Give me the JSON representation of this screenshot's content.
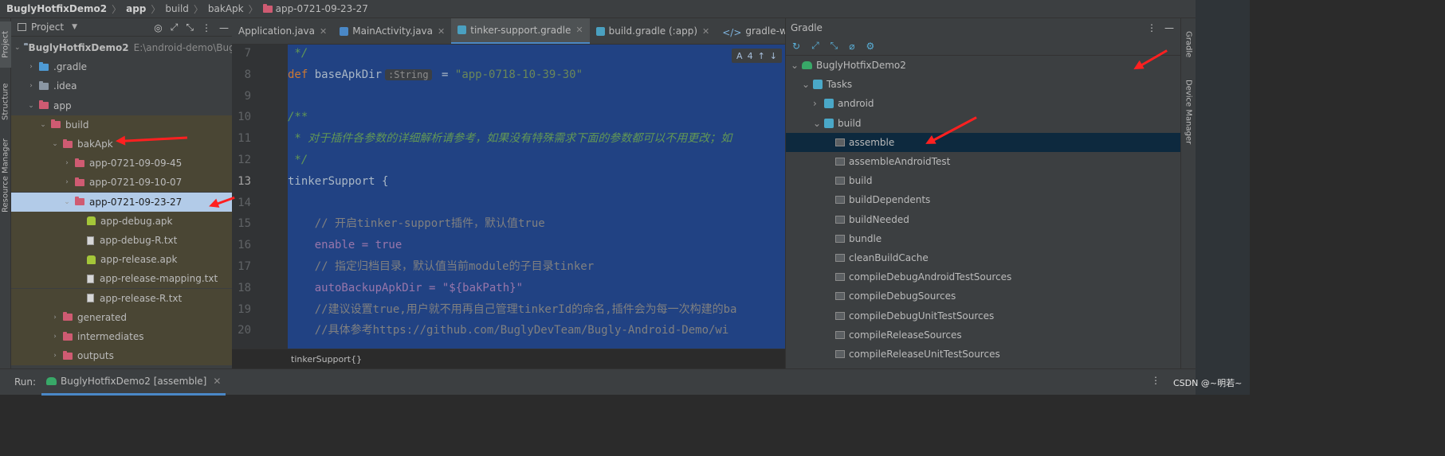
{
  "breadcrumb": {
    "items": [
      "BuglyHotfixDemo2",
      "app",
      "build",
      "bakApk",
      "app-0721-09-23-27"
    ],
    "separator": "〉"
  },
  "left_strip": {
    "tabs": [
      "Project",
      "Structure",
      "Resource Manager"
    ]
  },
  "project_panel": {
    "title": "Project",
    "tree": [
      {
        "label": "BuglyHotfixDemo2",
        "suffix": "E:\\android-demo\\BuglyHot",
        "depth": 0,
        "expanded": true,
        "icon": "folder-gray"
      },
      {
        "label": ".gradle",
        "depth": 1,
        "expanded": false,
        "icon": "folder-blue"
      },
      {
        "label": ".idea",
        "depth": 1,
        "expanded": false,
        "icon": "folder-gray"
      },
      {
        "label": "app",
        "depth": 1,
        "expanded": true,
        "icon": "folder-module"
      },
      {
        "label": "build",
        "depth": 2,
        "expanded": true,
        "icon": "folder-excluded"
      },
      {
        "label": "bakApk",
        "depth": 3,
        "expanded": true,
        "icon": "folder-excluded"
      },
      {
        "label": "app-0721-09-09-45",
        "depth": 4,
        "expanded": false,
        "icon": "folder-excluded"
      },
      {
        "label": "app-0721-09-10-07",
        "depth": 4,
        "expanded": false,
        "icon": "folder-excluded"
      },
      {
        "label": "app-0721-09-23-27",
        "depth": 4,
        "expanded": true,
        "icon": "folder-excluded",
        "selected": true
      },
      {
        "label": "app-debug.apk",
        "depth": 5,
        "icon": "apk"
      },
      {
        "label": "app-debug-R.txt",
        "depth": 5,
        "icon": "txt"
      },
      {
        "label": "app-release.apk",
        "depth": 5,
        "icon": "apk"
      },
      {
        "label": "app-release-mapping.txt",
        "depth": 5,
        "icon": "txt"
      },
      {
        "label": "app-release-R.txt",
        "depth": 5,
        "icon": "txt"
      },
      {
        "label": "generated",
        "depth": 3,
        "expanded": false,
        "icon": "folder-excluded"
      },
      {
        "label": "intermediates",
        "depth": 3,
        "expanded": false,
        "icon": "folder-excluded"
      },
      {
        "label": "outputs",
        "depth": 3,
        "expanded": false,
        "icon": "folder-excluded"
      }
    ]
  },
  "editor": {
    "tabs": [
      {
        "label": "Application.java",
        "active": false,
        "icon": "java-icon"
      },
      {
        "label": "MainActivity.java",
        "active": false,
        "icon": "java-icon"
      },
      {
        "label": "tinker-support.gradle",
        "active": true,
        "icon": "gradle-icon"
      },
      {
        "label": "build.gradle (:app)",
        "active": false,
        "icon": "gradle-icon"
      },
      {
        "label": "gradle-wrapper.propertie",
        "active": false,
        "icon": "properties-icon"
      }
    ],
    "hint_bar": {
      "count": "4"
    },
    "lines": [
      {
        "n": "7",
        "text": " */"
      },
      {
        "n": "8",
        "text": "def baseApkDir"
      },
      {
        "n": "9",
        "text": ""
      },
      {
        "n": "10",
        "text": "/**"
      },
      {
        "n": "11",
        "text": " * 对于插件各参数的详细解析请参考，如果没有特殊需求下面的参数都可以不用更改；如"
      },
      {
        "n": "12",
        "text": " */"
      },
      {
        "n": "13",
        "text": "tinkerSupport {"
      },
      {
        "n": "14",
        "text": ""
      },
      {
        "n": "15",
        "text": "    // 开启tinker-support插件，默认值true"
      },
      {
        "n": "16",
        "text": "    enable = true"
      },
      {
        "n": "17",
        "text": "    // 指定归档目录，默认值当前module的子目录tinker"
      },
      {
        "n": "18",
        "text": "    autoBackupApkDir = \"${bakPath}\""
      },
      {
        "n": "19",
        "text": "    //建议设置true,用户就不用再自己管理tinkerId的命名,插件会为每一次构建的ba"
      },
      {
        "n": "20",
        "text": "    //具体参考https://github.com/BuglyDevTeam/Bugly-Android-Demo/wi"
      }
    ],
    "line8": {
      "hint": ":String",
      "rest": " = ",
      "value": "\"app-0718-10-39-30\""
    },
    "status": "tinkerSupport{}"
  },
  "gradle_panel": {
    "title": "Gradle",
    "tree": [
      {
        "label": "BuglyHotfixDemo2",
        "depth": 0,
        "icon": "elephant"
      },
      {
        "label": "Tasks",
        "depth": 1,
        "icon": "gear"
      },
      {
        "label": "android",
        "depth": 2,
        "icon": "gear",
        "collapsed": true
      },
      {
        "label": "build",
        "depth": 2,
        "icon": "gear"
      },
      {
        "label": "assemble",
        "depth": 3,
        "icon": "task",
        "selected": true
      },
      {
        "label": "assembleAndroidTest",
        "depth": 3,
        "icon": "task"
      },
      {
        "label": "build",
        "depth": 3,
        "icon": "task"
      },
      {
        "label": "buildDependents",
        "depth": 3,
        "icon": "task"
      },
      {
        "label": "buildNeeded",
        "depth": 3,
        "icon": "task"
      },
      {
        "label": "bundle",
        "depth": 3,
        "icon": "task"
      },
      {
        "label": "cleanBuildCache",
        "depth": 3,
        "icon": "task"
      },
      {
        "label": "compileDebugAndroidTestSources",
        "depth": 3,
        "icon": "task"
      },
      {
        "label": "compileDebugSources",
        "depth": 3,
        "icon": "task"
      },
      {
        "label": "compileDebugUnitTestSources",
        "depth": 3,
        "icon": "task"
      },
      {
        "label": "compileReleaseSources",
        "depth": 3,
        "icon": "task"
      },
      {
        "label": "compileReleaseUnitTestSources",
        "depth": 3,
        "icon": "task"
      }
    ]
  },
  "right_strip": {
    "tabs": [
      "Gradle",
      "Device Manager"
    ]
  },
  "run_bar": {
    "label": "Run:",
    "tab": "BuglyHotfixDemo2 [assemble]"
  },
  "watermark": "CSDN @~明若~",
  "colors": {
    "accent": "#4a88c7",
    "selection": "#214283",
    "annotation": "#ff2020"
  }
}
